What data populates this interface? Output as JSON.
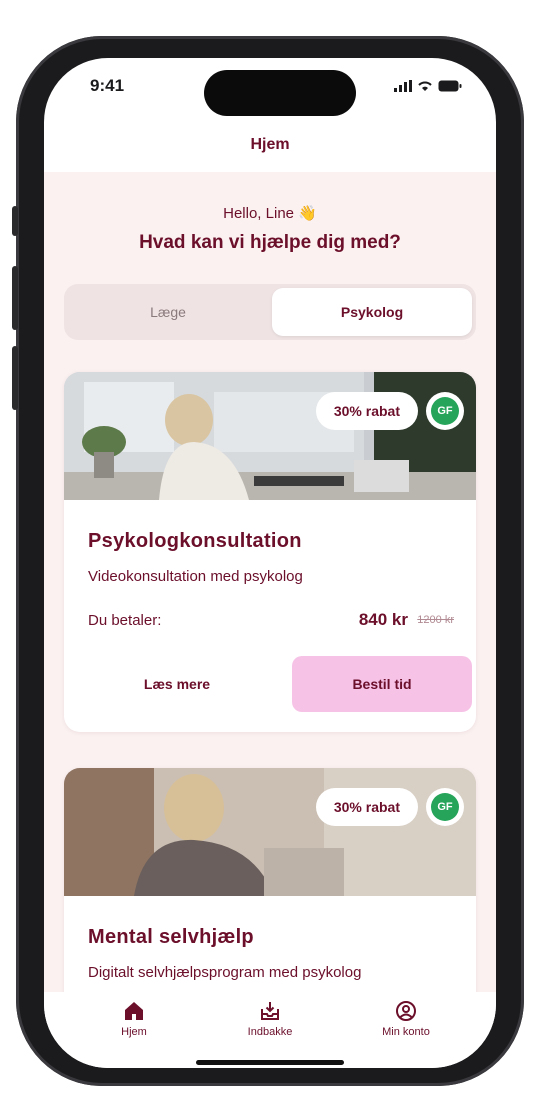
{
  "status_bar": {
    "time": "9:41"
  },
  "header": {
    "title": "Hjem"
  },
  "greeting": {
    "hello": "Hello, Line 👋",
    "question": "Hvad kan vi hjælpe dig med?"
  },
  "segment": {
    "left_label": "Læge",
    "right_label": "Psykolog",
    "selected": "Psykolog"
  },
  "cards": [
    {
      "badge": "30% rabat",
      "partner_badge": "GF",
      "title": "Psykologkonsultation",
      "subtitle": "Videokonsultation med psykolog",
      "price_label": "Du betaler:",
      "price": "840 kr",
      "old_price": "1200 kr",
      "more_button": "Læs mere",
      "book_button": "Bestil tid"
    },
    {
      "badge": "30% rabat",
      "partner_badge": "GF",
      "title": "Mental selvhjælp",
      "subtitle": "Digitalt selvhjælpsprogram med psykolog"
    }
  ],
  "tabbar": {
    "items": [
      {
        "label": "Hjem",
        "icon": "home-icon",
        "active": true
      },
      {
        "label": "Indbakke",
        "icon": "inbox-icon",
        "active": false
      },
      {
        "label": "Min konto",
        "icon": "account-icon",
        "active": false
      }
    ]
  },
  "colors": {
    "brand": "#6b0f2b",
    "background": "#fbf1f1",
    "accent_button": "#f6c2e6",
    "partner_green": "#25a45a"
  }
}
